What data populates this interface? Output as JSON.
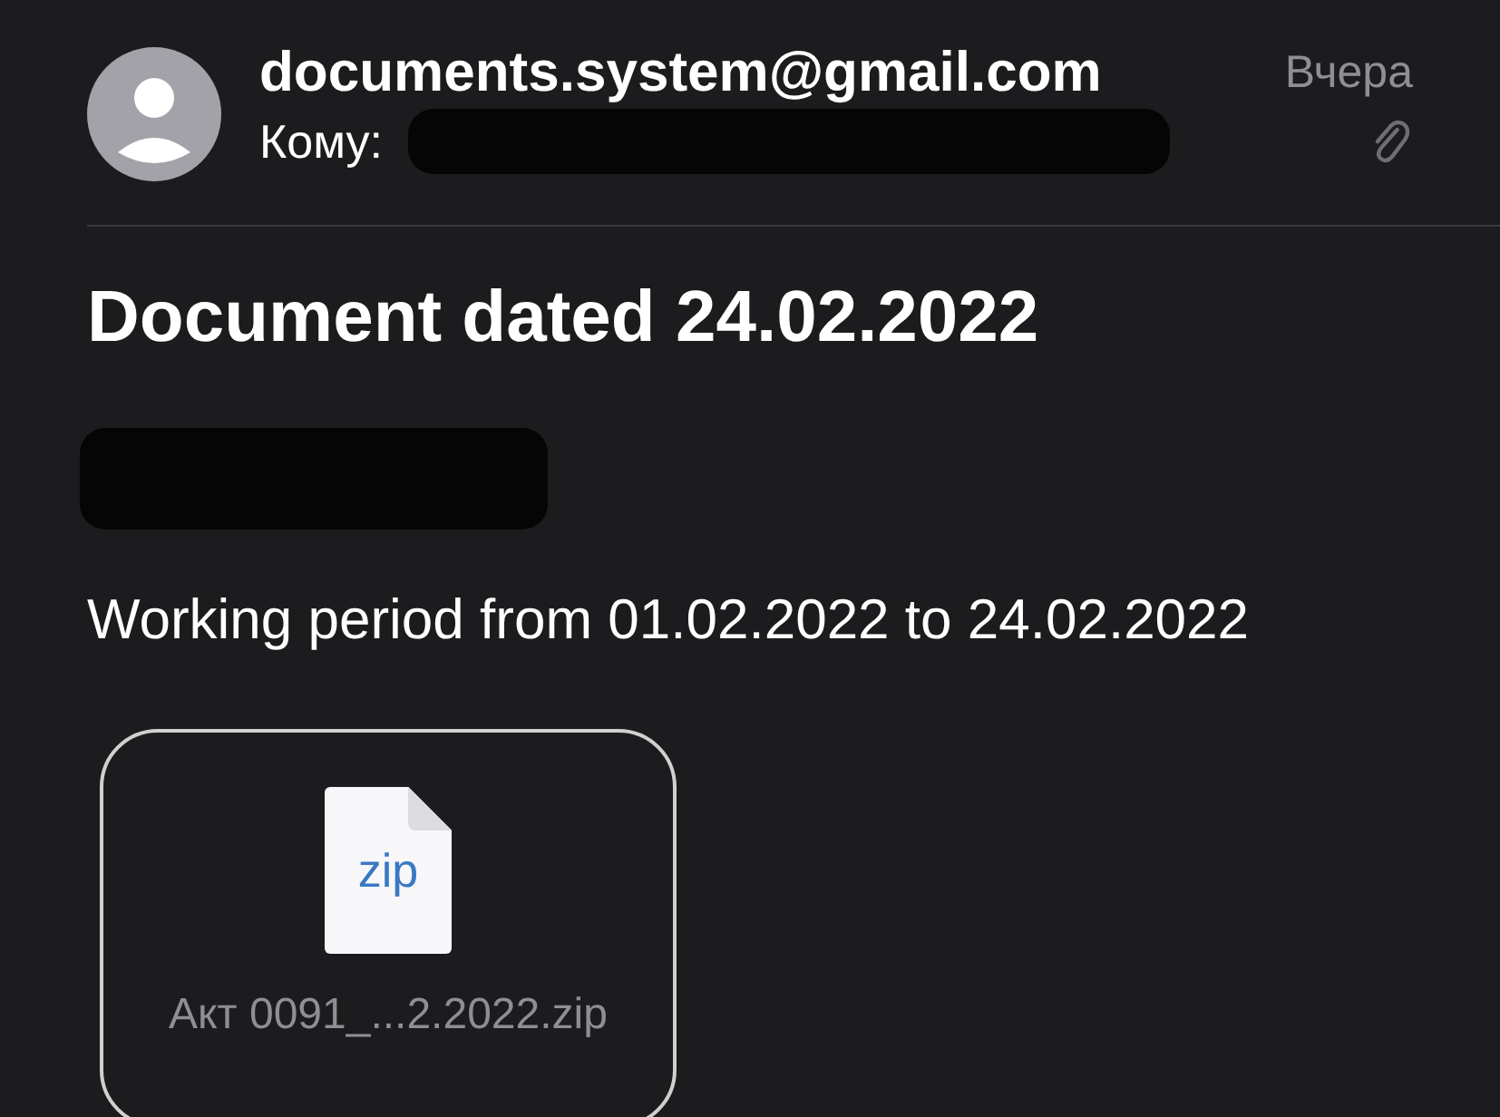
{
  "message": {
    "sender": "documents.system@gmail.com",
    "date": "Вчера",
    "to_label": "Кому:",
    "has_attachment": true,
    "subject": "Document dated 24.02.2022",
    "body": "Working period from 01.02.2022 to 24.02.2022"
  },
  "attachments": [
    {
      "file_type": "zip",
      "name": "Акт 0091_...2.2022.zip"
    }
  ]
}
